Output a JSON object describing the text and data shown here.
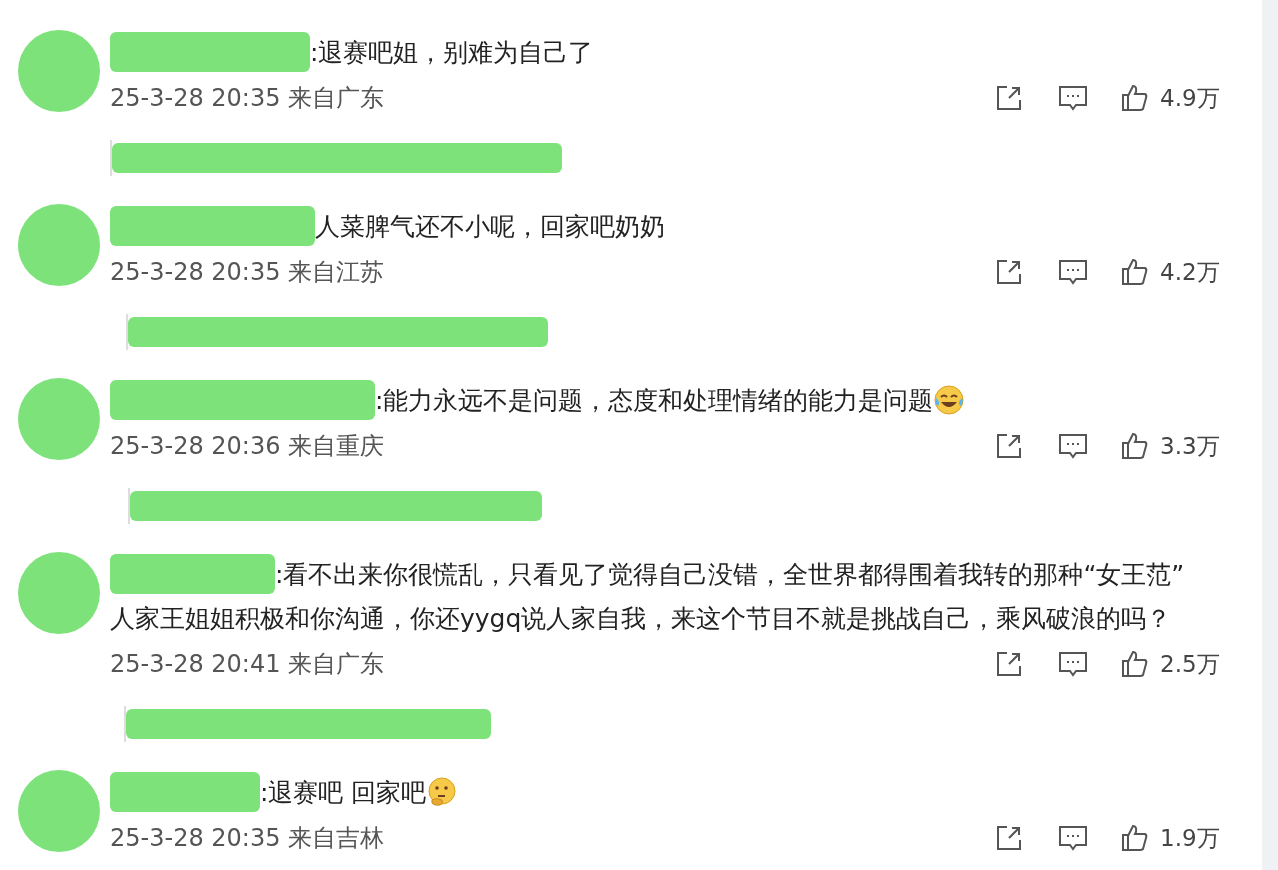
{
  "comments": [
    {
      "text": ":退赛吧姐，别难为自己了",
      "kind": "plain",
      "date": "25-3-28 20:35 来自广东",
      "likes": "4.9万",
      "has_reply": true
    },
    {
      "text": "人菜脾气还不小呢，回家吧奶奶",
      "kind": "plain",
      "date": "25-3-28 20:35 来自江苏",
      "likes": "4.2万",
      "has_reply": true
    },
    {
      "text": ":能力永远不是问题，态度和处理情绪的能力是问题",
      "kind": "tears-of-joy",
      "date": "25-3-28 20:36 来自重庆",
      "likes": "3.3万",
      "has_reply": true
    },
    {
      "text": ":看不出来你很慌乱，只看见了觉得自己没错，全世界都得围着我转的那种“女王范”",
      "text_2": "人家王姐姐积极和你沟通，你还yygq说人家自我，来这个节目不就是挑战自己，乘风破浪的吗？",
      "kind": "plain",
      "date": "25-3-28 20:41 来自广东",
      "likes": "2.5万",
      "has_reply": true
    },
    {
      "text": ":退赛吧 回家吧",
      "kind": "thinking",
      "date": "25-3-28 20:35 来自吉林",
      "likes": "1.9万",
      "has_reply": false
    }
  ]
}
